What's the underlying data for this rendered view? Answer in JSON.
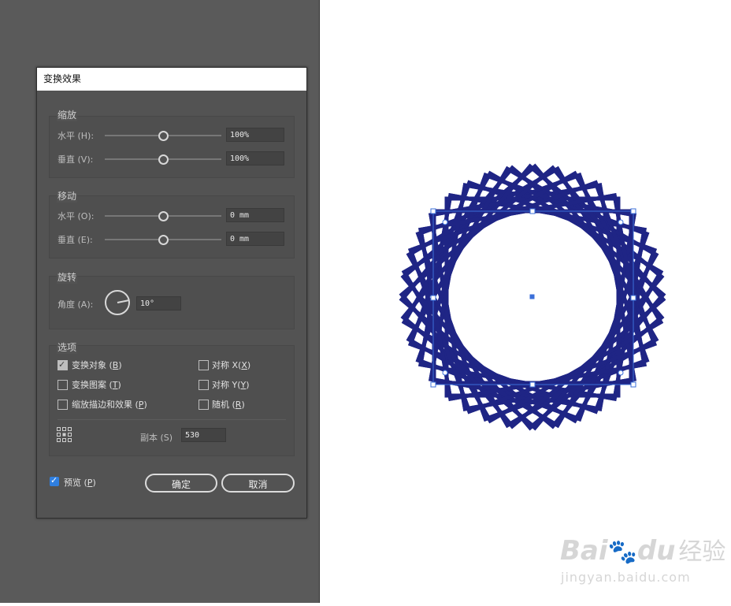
{
  "dialog": {
    "title": "变换效果",
    "scale": {
      "title": "缩放",
      "horizontal": {
        "label": "水平 (H):",
        "value": "100%",
        "slider": 0.5
      },
      "vertical": {
        "label": "垂直 (V):",
        "value": "100%",
        "slider": 0.5
      }
    },
    "move": {
      "title": "移动",
      "horizontal": {
        "label": "水平 (O):",
        "value": "0 mm",
        "slider": 0.5
      },
      "vertical": {
        "label": "垂直 (E):",
        "value": "0 mm",
        "slider": 0.5
      }
    },
    "rotate": {
      "title": "旋转",
      "angle_label": "角度 (A):",
      "angle_value": "10°"
    },
    "options": {
      "title": "选项",
      "transform_objects": {
        "label": "变换对象",
        "key": "B",
        "checked": true
      },
      "transform_patterns": {
        "label": "变换图案",
        "key": "T",
        "checked": false
      },
      "scale_strokes": {
        "label": "缩放描边和效果",
        "key": "P",
        "checked": false
      },
      "reflect_x": {
        "label": "对称 X",
        "key": "X",
        "checked": false
      },
      "reflect_y": {
        "label": "对称 Y",
        "key": "Y",
        "checked": false
      },
      "random": {
        "label": "随机",
        "key": "R",
        "checked": false
      },
      "copies_label": "副本 (S)",
      "copies_value": "530"
    },
    "preview": {
      "label": "预览",
      "key": "P",
      "checked": true
    },
    "ok_label": "确定",
    "cancel_label": "取消"
  },
  "artwork": {
    "stroke_color": "#1f2585",
    "selection_color": "#3b6fd9"
  },
  "watermark": {
    "brand": "Bai",
    "brand_tail": "du",
    "suffix": "经验",
    "url": "jingyan.baidu.com"
  }
}
